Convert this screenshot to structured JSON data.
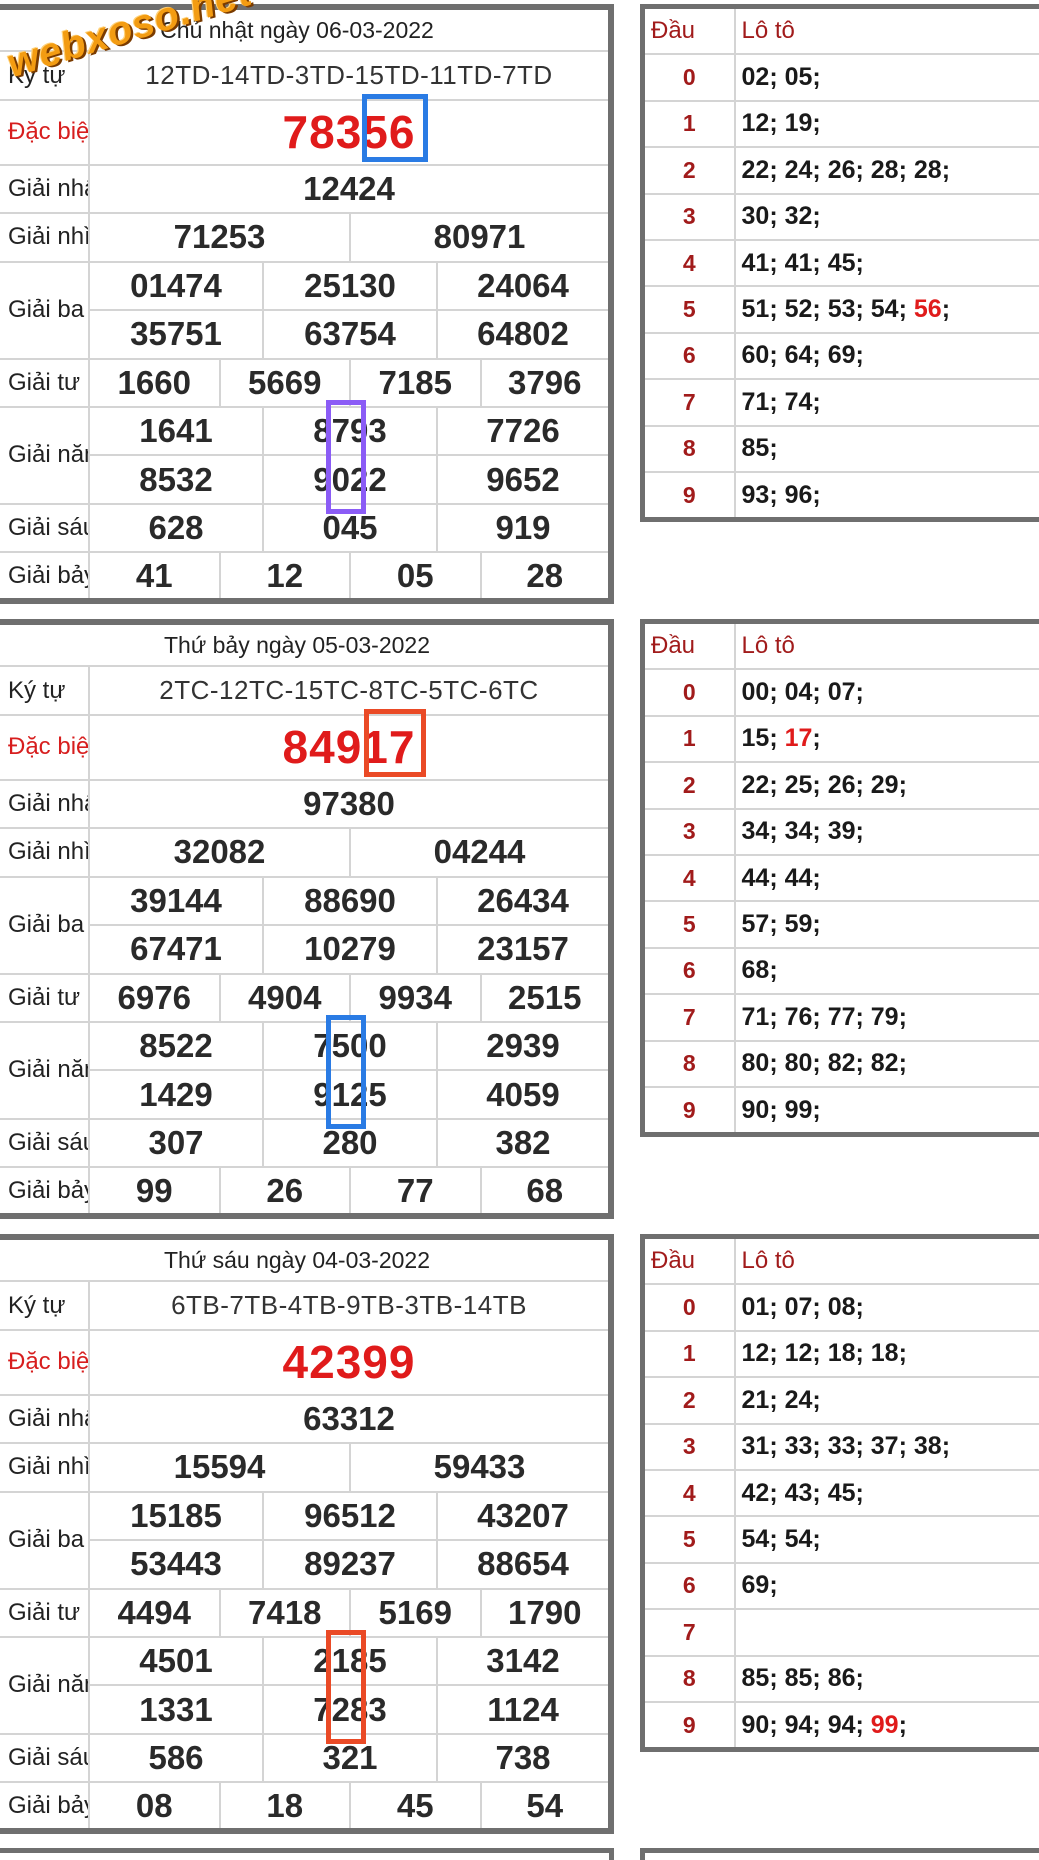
{
  "labels": {
    "ky_tu": "Ký tự",
    "dac_biet": "Đặc biệt",
    "giai_nhat": "Giải nhất",
    "giai_nhi": "Giải nhì",
    "giai_ba": "Giải ba",
    "giai_tu": "Giải tư",
    "giai_nam": "Giải năm",
    "giai_sau": "Giải sáu",
    "giai_bay": "Giải bảy",
    "dau": "Đầu",
    "loto": "Lô tô"
  },
  "watermark": "webxoso.net",
  "colors": {
    "special": "#e01b1b",
    "dau": "#a11b1b",
    "border": "#6f6f6f"
  },
  "draws": [
    {
      "date": "Chủ nhật ngày 06-03-2022",
      "code": "12TD-14TD-3TD-15TD-11TD-7TD",
      "special": "78356",
      "first": "12424",
      "second": [
        "71253",
        "80971"
      ],
      "third": [
        "01474",
        "25130",
        "24064",
        "35751",
        "63754",
        "64802"
      ],
      "fourth": [
        "1660",
        "5669",
        "7185",
        "3796"
      ],
      "fifth": [
        "1641",
        "8793",
        "7726",
        "8532",
        "9022",
        "9652"
      ],
      "sixth": [
        "628",
        "045",
        "919"
      ],
      "seventh": [
        "41",
        "12",
        "05",
        "28"
      ],
      "loto": [
        {
          "dau": "0",
          "nums": [
            {
              "v": "02"
            },
            {
              "v": "05"
            }
          ]
        },
        {
          "dau": "1",
          "nums": [
            {
              "v": "12"
            },
            {
              "v": "19"
            }
          ]
        },
        {
          "dau": "2",
          "nums": [
            {
              "v": "22"
            },
            {
              "v": "24"
            },
            {
              "v": "26"
            },
            {
              "v": "28"
            },
            {
              "v": "28"
            }
          ]
        },
        {
          "dau": "3",
          "nums": [
            {
              "v": "30"
            },
            {
              "v": "32"
            }
          ]
        },
        {
          "dau": "4",
          "nums": [
            {
              "v": "41"
            },
            {
              "v": "41"
            },
            {
              "v": "45"
            }
          ]
        },
        {
          "dau": "5",
          "nums": [
            {
              "v": "51"
            },
            {
              "v": "52"
            },
            {
              "v": "53"
            },
            {
              "v": "54"
            },
            {
              "v": "56",
              "hl": true
            }
          ]
        },
        {
          "dau": "6",
          "nums": [
            {
              "v": "60"
            },
            {
              "v": "64"
            },
            {
              "v": "69"
            }
          ]
        },
        {
          "dau": "7",
          "nums": [
            {
              "v": "71"
            },
            {
              "v": "74"
            }
          ]
        },
        {
          "dau": "8",
          "nums": [
            {
              "v": "85"
            }
          ]
        },
        {
          "dau": "9",
          "nums": [
            {
              "v": "93"
            },
            {
              "v": "96"
            }
          ]
        }
      ]
    },
    {
      "date": "Thứ bảy ngày 05-03-2022",
      "code": "2TC-12TC-15TC-8TC-5TC-6TC",
      "special": "84917",
      "first": "97380",
      "second": [
        "32082",
        "04244"
      ],
      "third": [
        "39144",
        "88690",
        "26434",
        "67471",
        "10279",
        "23157"
      ],
      "fourth": [
        "6976",
        "4904",
        "9934",
        "2515"
      ],
      "fifth": [
        "8522",
        "7500",
        "2939",
        "1429",
        "9125",
        "4059"
      ],
      "sixth": [
        "307",
        "280",
        "382"
      ],
      "seventh": [
        "99",
        "26",
        "77",
        "68"
      ],
      "loto": [
        {
          "dau": "0",
          "nums": [
            {
              "v": "00"
            },
            {
              "v": "04"
            },
            {
              "v": "07"
            }
          ]
        },
        {
          "dau": "1",
          "nums": [
            {
              "v": "15"
            },
            {
              "v": "17",
              "hl": true
            }
          ]
        },
        {
          "dau": "2",
          "nums": [
            {
              "v": "22"
            },
            {
              "v": "25"
            },
            {
              "v": "26"
            },
            {
              "v": "29"
            }
          ]
        },
        {
          "dau": "3",
          "nums": [
            {
              "v": "34"
            },
            {
              "v": "34"
            },
            {
              "v": "39"
            }
          ]
        },
        {
          "dau": "4",
          "nums": [
            {
              "v": "44"
            },
            {
              "v": "44"
            }
          ]
        },
        {
          "dau": "5",
          "nums": [
            {
              "v": "57"
            },
            {
              "v": "59"
            }
          ]
        },
        {
          "dau": "6",
          "nums": [
            {
              "v": "68"
            }
          ]
        },
        {
          "dau": "7",
          "nums": [
            {
              "v": "71"
            },
            {
              "v": "76"
            },
            {
              "v": "77"
            },
            {
              "v": "79"
            }
          ]
        },
        {
          "dau": "8",
          "nums": [
            {
              "v": "80"
            },
            {
              "v": "80"
            },
            {
              "v": "82"
            },
            {
              "v": "82"
            }
          ]
        },
        {
          "dau": "9",
          "nums": [
            {
              "v": "90"
            },
            {
              "v": "99"
            }
          ]
        }
      ]
    },
    {
      "date": "Thứ sáu ngày 04-03-2022",
      "code": "6TB-7TB-4TB-9TB-3TB-14TB",
      "special": "42399",
      "first": "63312",
      "second": [
        "15594",
        "59433"
      ],
      "third": [
        "15185",
        "96512",
        "43207",
        "53443",
        "89237",
        "88654"
      ],
      "fourth": [
        "4494",
        "7418",
        "5169",
        "1790"
      ],
      "fifth": [
        "4501",
        "2185",
        "3142",
        "1331",
        "7283",
        "1124"
      ],
      "sixth": [
        "586",
        "321",
        "738"
      ],
      "seventh": [
        "08",
        "18",
        "45",
        "54"
      ],
      "loto": [
        {
          "dau": "0",
          "nums": [
            {
              "v": "01"
            },
            {
              "v": "07"
            },
            {
              "v": "08"
            }
          ]
        },
        {
          "dau": "1",
          "nums": [
            {
              "v": "12"
            },
            {
              "v": "12"
            },
            {
              "v": "18"
            },
            {
              "v": "18"
            }
          ]
        },
        {
          "dau": "2",
          "nums": [
            {
              "v": "21"
            },
            {
              "v": "24"
            }
          ]
        },
        {
          "dau": "3",
          "nums": [
            {
              "v": "31"
            },
            {
              "v": "33"
            },
            {
              "v": "33"
            },
            {
              "v": "37"
            },
            {
              "v": "38"
            }
          ]
        },
        {
          "dau": "4",
          "nums": [
            {
              "v": "42"
            },
            {
              "v": "43"
            },
            {
              "v": "45"
            }
          ]
        },
        {
          "dau": "5",
          "nums": [
            {
              "v": "54"
            },
            {
              "v": "54"
            }
          ]
        },
        {
          "dau": "6",
          "nums": [
            {
              "v": "69"
            }
          ]
        },
        {
          "dau": "7",
          "nums": []
        },
        {
          "dau": "8",
          "nums": [
            {
              "v": "85"
            },
            {
              "v": "85"
            },
            {
              "v": "86"
            }
          ]
        },
        {
          "dau": "9",
          "nums": [
            {
              "v": "90"
            },
            {
              "v": "94"
            },
            {
              "v": "94"
            },
            {
              "v": "99",
              "hl": true
            }
          ]
        }
      ]
    }
  ]
}
